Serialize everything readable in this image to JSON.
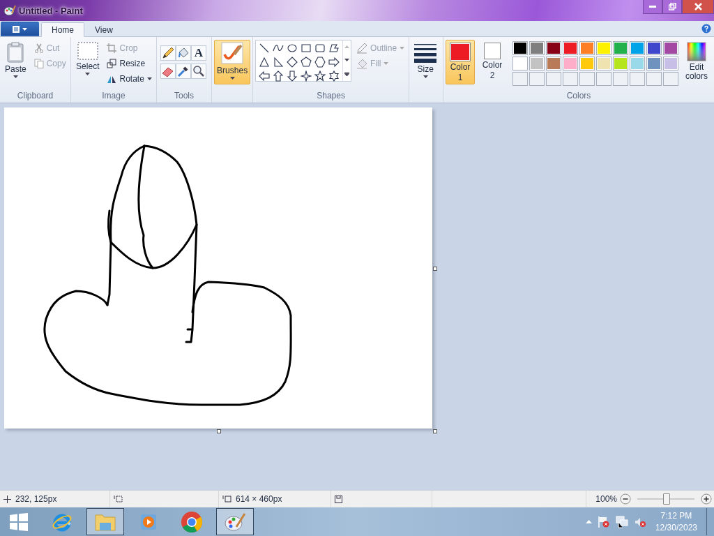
{
  "window": {
    "title": "Untitled - Paint"
  },
  "tabs": [
    {
      "label": "Home",
      "selected": true
    },
    {
      "label": "View",
      "selected": false
    }
  ],
  "ribbon": {
    "clipboard": {
      "label": "Clipboard",
      "paste": "Paste",
      "cut": {
        "label": "Cut",
        "disabled": true
      },
      "copy": {
        "label": "Copy",
        "disabled": true
      }
    },
    "image": {
      "label": "Image",
      "select": "Select",
      "crop": {
        "label": "Crop",
        "disabled": true
      },
      "resize": {
        "label": "Resize",
        "disabled": false
      },
      "rotate": {
        "label": "Rotate",
        "disabled": false
      }
    },
    "tools": {
      "label": "Tools",
      "text_tool": "A"
    },
    "brushes": {
      "label": "Brushes",
      "selected": true
    },
    "shapes": {
      "label": "Shapes",
      "outline": {
        "label": "Outline",
        "disabled": true
      },
      "fill": {
        "label": "Fill",
        "disabled": true
      }
    },
    "size": {
      "label": "Size"
    },
    "colors": {
      "label": "Colors",
      "edit": "Edit colors",
      "slots": [
        {
          "label": "Color",
          "number": "1",
          "color": "#ed1c24",
          "selected": true
        },
        {
          "label": "Color",
          "number": "2",
          "color": "#ffffff",
          "selected": false
        }
      ],
      "palette": [
        {
          "color": "#000000"
        },
        {
          "color": "#7f7f7f"
        },
        {
          "color": "#880015"
        },
        {
          "color": "#ed1c24"
        },
        {
          "color": "#ff7f27"
        },
        {
          "color": "#fff200"
        },
        {
          "color": "#22b14c"
        },
        {
          "color": "#00a2e8"
        },
        {
          "color": "#3f48cc"
        },
        {
          "color": "#a349a4"
        },
        {
          "color": "#ffffff"
        },
        {
          "color": "#c3c3c3"
        },
        {
          "color": "#b97a57"
        },
        {
          "color": "#ffaec9"
        },
        {
          "color": "#ffc90e"
        },
        {
          "color": "#efe4b0"
        },
        {
          "color": "#b5e61d"
        },
        {
          "color": "#99d9ea"
        },
        {
          "color": "#7092be"
        },
        {
          "color": "#c8bfe7"
        }
      ]
    }
  },
  "status_bar": {
    "cursor": "232, 125px",
    "canvas_size": "614 × 460px",
    "zoom": "100%",
    "zoom_slider": {
      "level": 0.5
    }
  },
  "taskbar": {
    "time": "7:12 PM",
    "date": "12/30/2023"
  }
}
